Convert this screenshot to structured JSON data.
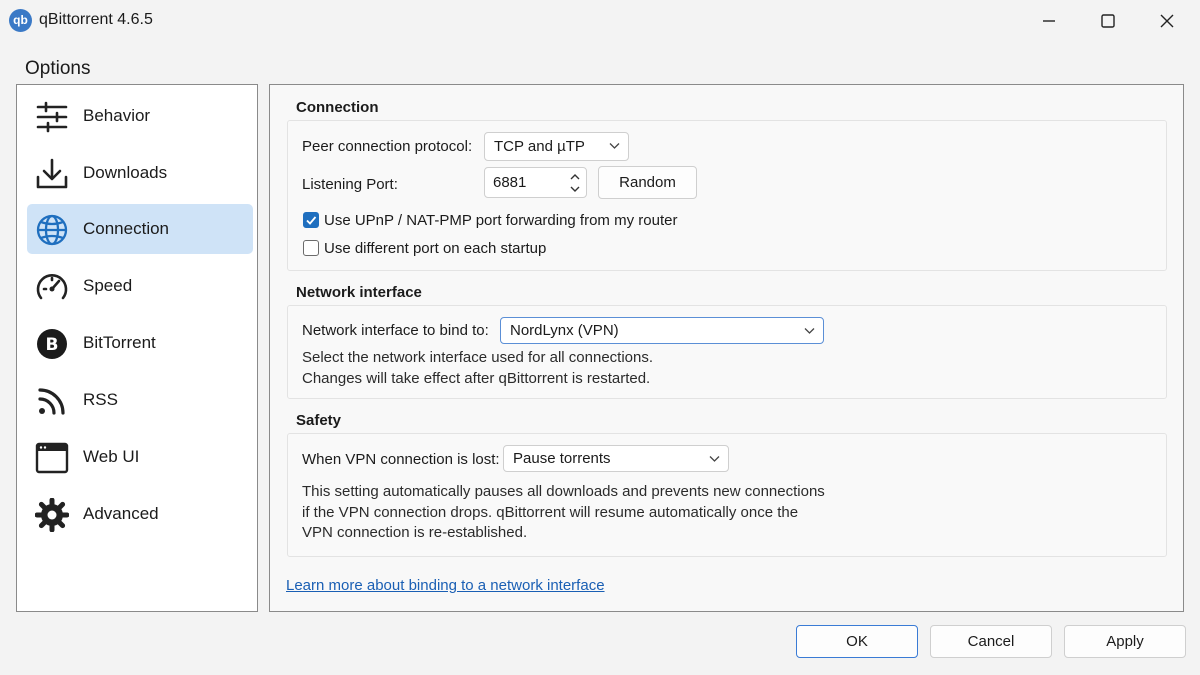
{
  "window": {
    "title": "qBittorrent 4.6.5",
    "app_icon_text": "qb",
    "controls": {
      "minimize": "minimize-icon",
      "maximize": "maximize-icon",
      "close": "close-icon"
    }
  },
  "options_title": "Options",
  "sidebar": {
    "items": [
      {
        "label": "Behavior",
        "icon": "sliders-icon",
        "selected": false
      },
      {
        "label": "Downloads",
        "icon": "download-icon",
        "selected": false
      },
      {
        "label": "Connection",
        "icon": "globe-icon",
        "selected": true
      },
      {
        "label": "Speed",
        "icon": "speedometer-icon",
        "selected": false
      },
      {
        "label": "BitTorrent",
        "icon": "bittorrent-icon",
        "selected": false
      },
      {
        "label": "RSS",
        "icon": "rss-icon",
        "selected": false
      },
      {
        "label": "Web UI",
        "icon": "browser-window-icon",
        "selected": false
      },
      {
        "label": "Advanced",
        "icon": "gear-icon",
        "selected": false
      }
    ]
  },
  "connection": {
    "title": "Connection",
    "protocol_label": "Peer connection protocol:",
    "protocol_value": "TCP and µTP",
    "port_label": "Listening Port:",
    "port_value": "6881",
    "random_button": "Random",
    "upnp_label": "Use UPnP / NAT-PMP port forwarding from my router",
    "upnp_checked": true,
    "diff_port_label": "Use different port on each startup",
    "diff_port_checked": false
  },
  "network_interface": {
    "title": "Network interface",
    "bind_label": "Network interface to bind to:",
    "bind_value": "NordLynx (VPN)",
    "desc_line1": "Select the network interface used for all connections.",
    "desc_line2": "Changes will take effect after qBittorrent is restarted."
  },
  "safety": {
    "title": "Safety",
    "vpn_lost_label": "When VPN connection is lost:",
    "vpn_lost_value": "Pause torrents",
    "desc_line1": "This setting automatically pauses all downloads and prevents new connections",
    "desc_line2": "if the VPN connection drops. qBittorrent will resume automatically once the",
    "desc_line3": "VPN connection is re-established."
  },
  "learn_more_link": "Learn more about binding to a network interface",
  "footer": {
    "ok": "OK",
    "cancel": "Cancel",
    "apply": "Apply"
  },
  "colors": {
    "accent": "#1f6fbf",
    "selected_bg": "#cfe3f7",
    "link": "#1a5fb4"
  }
}
